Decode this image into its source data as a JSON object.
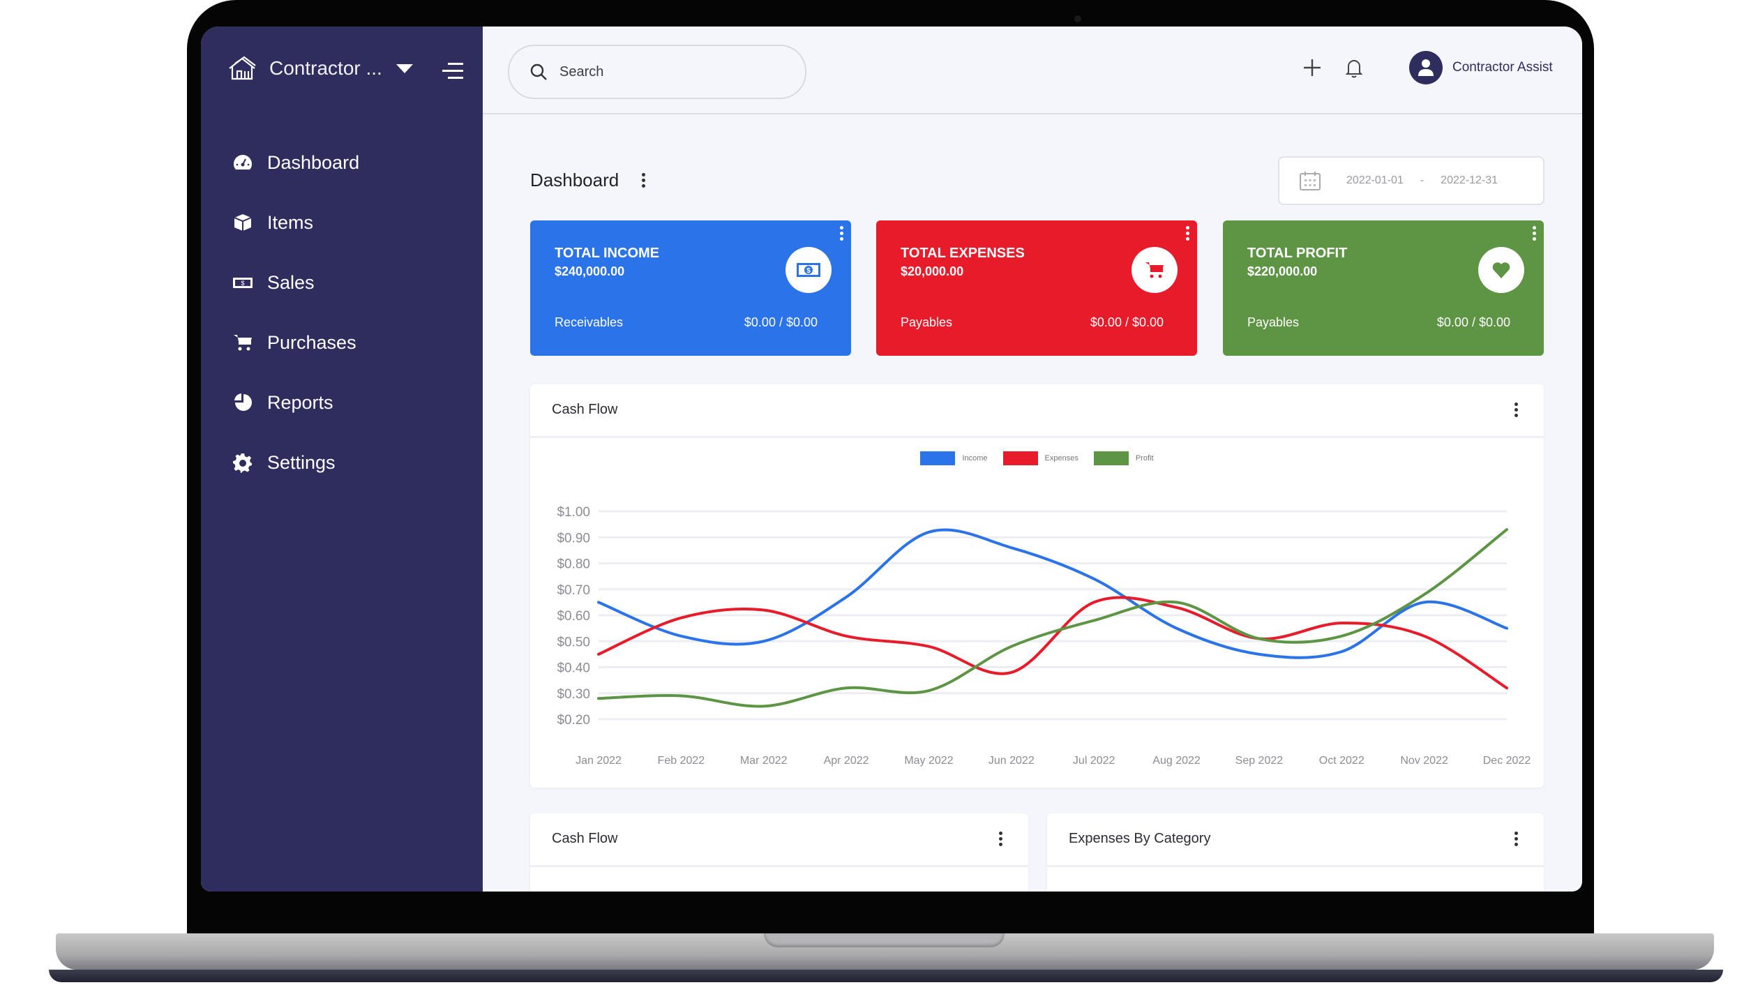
{
  "sidebar": {
    "brand": "Contractor ...",
    "items": [
      {
        "label": "Dashboard",
        "icon": "dashboard-icon"
      },
      {
        "label": "Items",
        "icon": "box-icon"
      },
      {
        "label": "Sales",
        "icon": "money-icon"
      },
      {
        "label": "Purchases",
        "icon": "cart-icon"
      },
      {
        "label": "Reports",
        "icon": "pie-chart-icon"
      },
      {
        "label": "Settings",
        "icon": "gear-icon"
      }
    ]
  },
  "header": {
    "search_placeholder": "Search",
    "user_name": "Contractor Assist"
  },
  "page": {
    "title": "Dashboard",
    "date_from": "2022-01-01",
    "date_separator": "-",
    "date_to": "2022-12-31"
  },
  "kpis": [
    {
      "title": "TOTAL INCOME",
      "value": "$240,000.00",
      "sub_label": "Receivables",
      "ratio": "$0.00 / $0.00",
      "color": "#2a73e8",
      "icon": "money-icon"
    },
    {
      "title": "TOTAL EXPENSES",
      "value": "$20,000.00",
      "sub_label": "Payables",
      "ratio": "$0.00 / $0.00",
      "color": "#e81b2a",
      "icon": "cart-icon"
    },
    {
      "title": "TOTAL PROFIT",
      "value": "$220,000.00",
      "sub_label": "Payables",
      "ratio": "$0.00 / $0.00",
      "color": "#5e9545",
      "icon": "heart-icon"
    }
  ],
  "cards": {
    "cash_flow_title": "Cash Flow",
    "bottom_left_title": "Cash Flow",
    "bottom_right_title": "Expenses By Category"
  },
  "chart_data": {
    "type": "line",
    "title": "Cash Flow",
    "xlabel": "",
    "ylabel": "",
    "categories": [
      "Jan 2022",
      "Feb 2022",
      "Mar 2022",
      "Apr 2022",
      "May 2022",
      "Jun 2022",
      "Jul 2022",
      "Aug 2022",
      "Sep 2022",
      "Oct 2022",
      "Nov 2022",
      "Dec 2022"
    ],
    "ylim": [
      0.2,
      1.0
    ],
    "yticks": [
      "$1.00",
      "$0.90",
      "$0.80",
      "$0.70",
      "$0.60",
      "$0.50",
      "$0.40",
      "$0.30",
      "$0.20"
    ],
    "grid": true,
    "legend": "top-center",
    "series": [
      {
        "name": "Income",
        "color": "#2a73e8",
        "values": [
          0.65,
          0.52,
          0.5,
          0.67,
          0.92,
          0.86,
          0.74,
          0.55,
          0.45,
          0.46,
          0.65,
          0.55
        ]
      },
      {
        "name": "Expenses",
        "color": "#e81b2a",
        "values": [
          0.45,
          0.59,
          0.62,
          0.52,
          0.48,
          0.38,
          0.65,
          0.63,
          0.51,
          0.57,
          0.52,
          0.32
        ]
      },
      {
        "name": "Profit",
        "color": "#5e9545",
        "values": [
          0.28,
          0.29,
          0.25,
          0.32,
          0.31,
          0.48,
          0.58,
          0.65,
          0.51,
          0.52,
          0.68,
          0.93
        ]
      }
    ]
  }
}
